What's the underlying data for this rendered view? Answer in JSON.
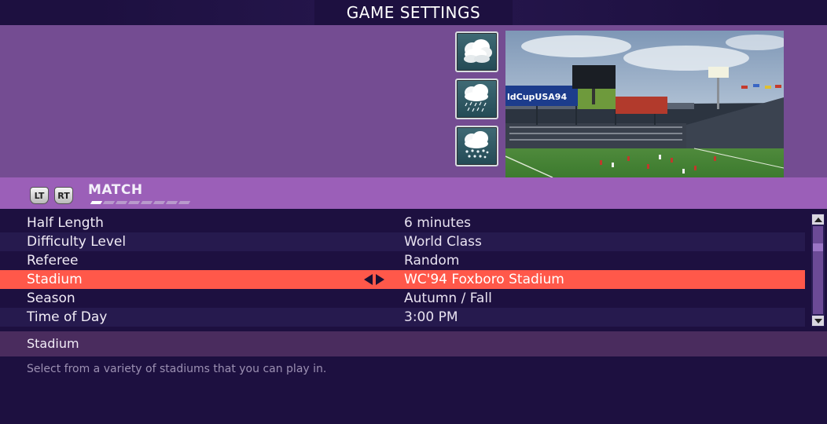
{
  "screen": {
    "title": "GAME SETTINGS"
  },
  "weather_options": [
    {
      "name": "cloudy",
      "icon": "cloud-icon"
    },
    {
      "name": "rain",
      "icon": "rain-cloud-icon"
    },
    {
      "name": "snow",
      "icon": "snow-cloud-icon"
    }
  ],
  "preview": {
    "stadium_banner_text": "ldCupUSA94"
  },
  "tabbar": {
    "left_shoulder": "LT",
    "right_shoulder": "RT",
    "current_tab": "MATCH",
    "page_count": 8,
    "active_page": 1
  },
  "settings": [
    {
      "label": "Half Length",
      "value": "6 minutes"
    },
    {
      "label": "Difficulty Level",
      "value": "World Class"
    },
    {
      "label": "Referee",
      "value": "Random"
    },
    {
      "label": "Stadium",
      "value": "WC'94 Foxboro Stadium",
      "selected": true
    },
    {
      "label": "Season",
      "value": "Autumn / Fall"
    },
    {
      "label": "Time of Day",
      "value": "3:00 PM"
    }
  ],
  "help": {
    "title": "Stadium",
    "description": "Select from a variety of stadiums that you can play in."
  },
  "colors": {
    "background": "#1d1040",
    "banner": "#744c92",
    "tabbar": "#9b5fb8",
    "selected_row": "#ff584a",
    "help_title_bar": "#4a2c5e"
  }
}
